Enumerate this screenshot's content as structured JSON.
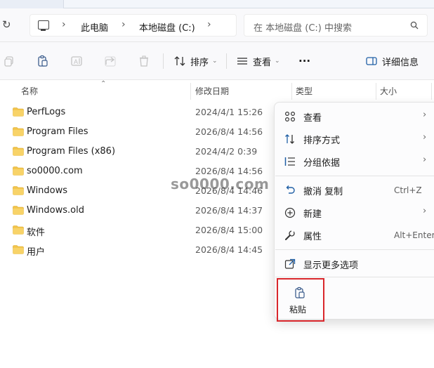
{
  "breadcrumb": {
    "items": [
      "此电脑",
      "本地磁盘 (C:)"
    ]
  },
  "search": {
    "placeholder": "在 本地磁盘 (C:) 中搜索"
  },
  "toolbar": {
    "sort_label": "排序",
    "view_label": "查看",
    "more_label": "···",
    "details_label": "详细信息"
  },
  "columns": {
    "name": "名称",
    "date": "修改日期",
    "type": "类型",
    "size": "大小"
  },
  "files": [
    {
      "name": "PerfLogs",
      "date": "2024/4/1 15:26"
    },
    {
      "name": "Program Files",
      "date": "2026/8/4 14:56"
    },
    {
      "name": "Program Files (x86)",
      "date": "2024/4/2 0:39"
    },
    {
      "name": "so0000.com",
      "date": "2026/8/4 14:56"
    },
    {
      "name": "Windows",
      "date": "2026/8/4 14:46"
    },
    {
      "name": "Windows.old",
      "date": "2026/8/4 14:37"
    },
    {
      "name": "软件",
      "date": "2026/8/4 15:00"
    },
    {
      "name": "用户",
      "date": "2026/8/4 14:45"
    }
  ],
  "watermark": "so0000.com",
  "context_menu": {
    "items": [
      {
        "label": "查看",
        "icon": "grid-view-icon",
        "arrow": "›"
      },
      {
        "label": "排序方式",
        "icon": "sort-icon",
        "arrow": "›"
      },
      {
        "label": "分组依据",
        "icon": "group-list-icon",
        "arrow": "›"
      },
      {
        "label": "撤消 复制",
        "icon": "undo-icon",
        "shortcut": "Ctrl+Z"
      },
      {
        "label": "新建",
        "icon": "new-plus-icon",
        "arrow": "›"
      },
      {
        "label": "属性",
        "icon": "wrench-icon",
        "shortcut": "Alt+Enter"
      },
      {
        "label": "显示更多选项",
        "icon": "open-external-icon"
      }
    ],
    "paste_label": "粘贴"
  },
  "colors": {
    "accent": "#0067c0",
    "folder": "#f3c44b",
    "highlight_border": "#d9262b"
  }
}
